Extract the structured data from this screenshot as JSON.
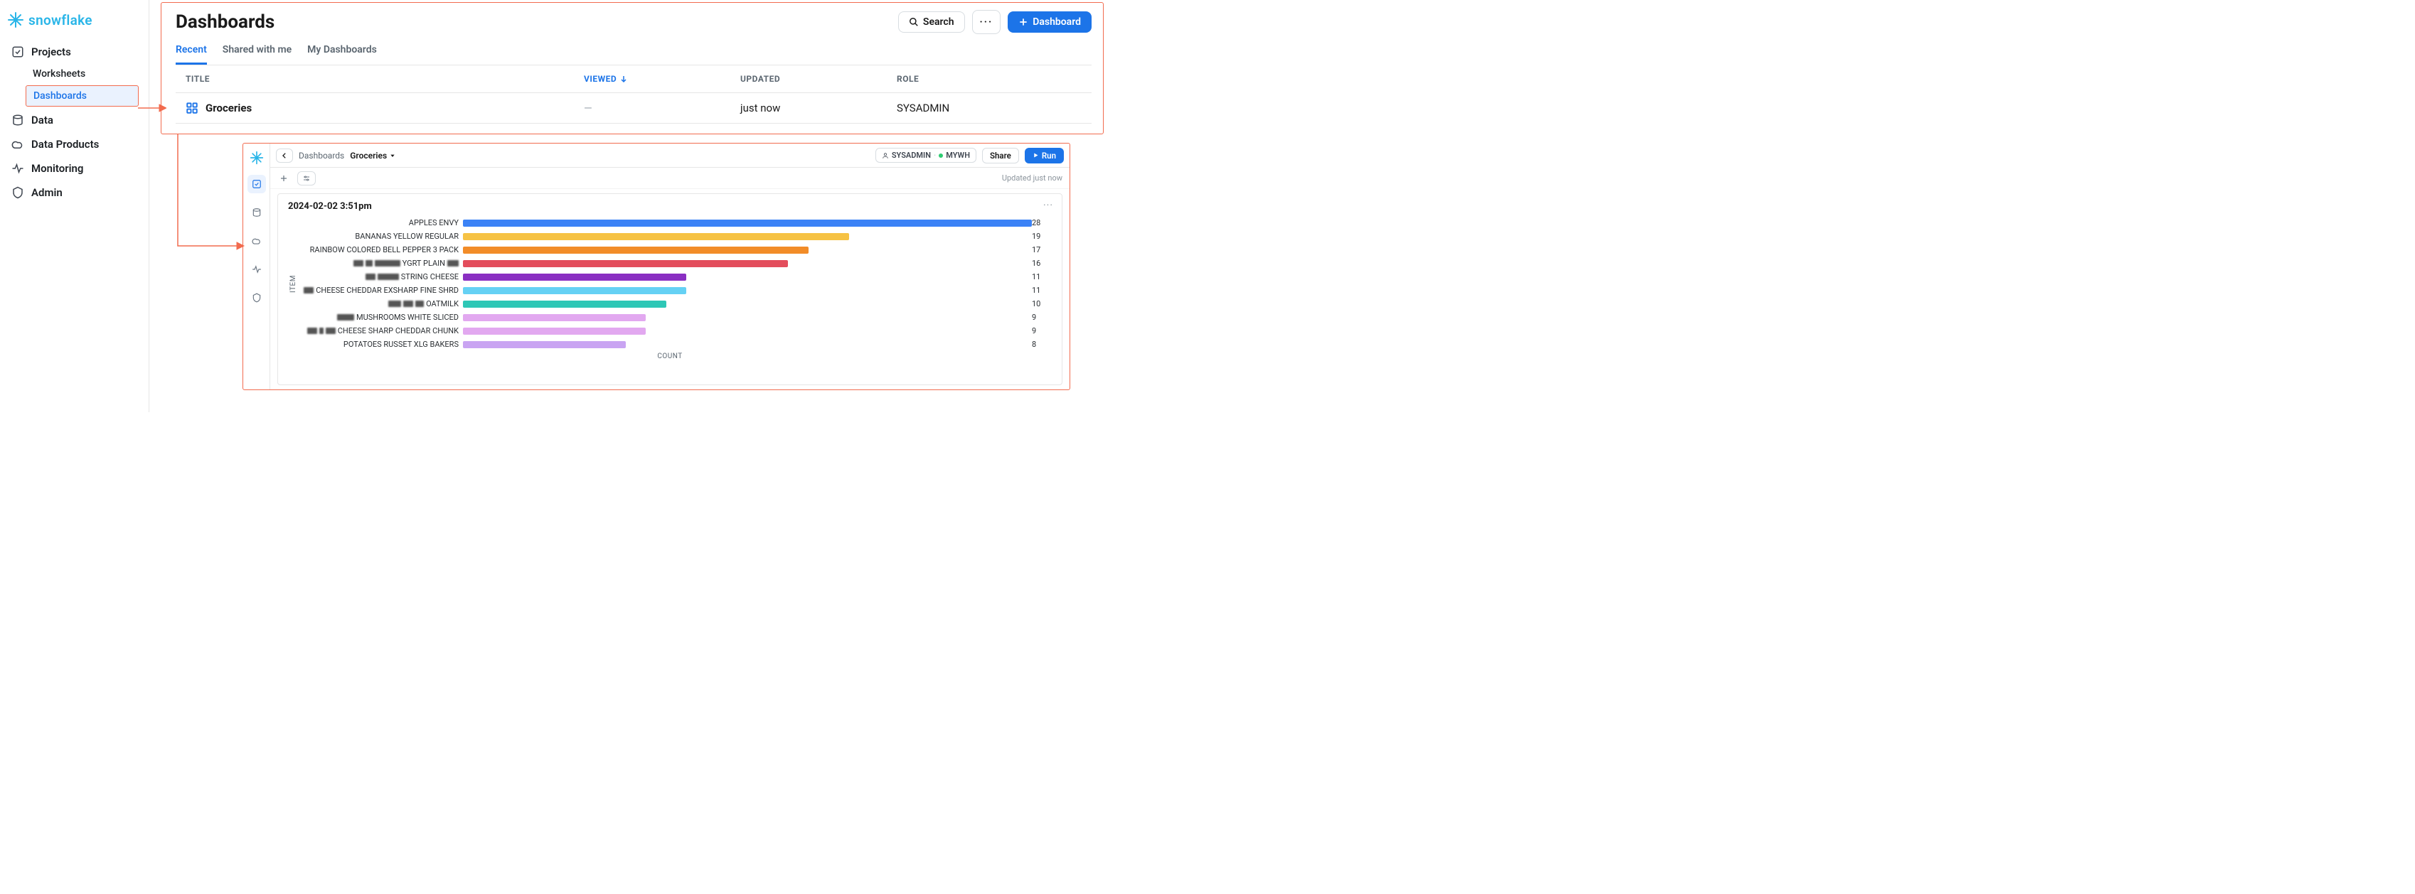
{
  "brand": "snowflake",
  "sidebar": {
    "items": [
      {
        "label": "Projects",
        "icon": "projects-icon"
      },
      {
        "label": "Data",
        "icon": "data-icon"
      },
      {
        "label": "Data Products",
        "icon": "data-products-icon"
      },
      {
        "label": "Monitoring",
        "icon": "monitoring-icon"
      },
      {
        "label": "Admin",
        "icon": "admin-icon"
      }
    ],
    "projects_sub": [
      {
        "label": "Worksheets",
        "active": false
      },
      {
        "label": "Dashboards",
        "active": true
      }
    ]
  },
  "main": {
    "title": "Dashboards",
    "search_label": "Search",
    "new_label": "Dashboard",
    "tabs": [
      {
        "label": "Recent",
        "active": true
      },
      {
        "label": "Shared with me",
        "active": false
      },
      {
        "label": "My Dashboards",
        "active": false
      }
    ],
    "cols": {
      "title": "TITLE",
      "viewed": "VIEWED",
      "updated": "UPDATED",
      "role": "ROLE"
    },
    "rows": [
      {
        "title": "Groceries",
        "viewed": "—",
        "updated": "just now",
        "role": "SYSADMIN"
      }
    ]
  },
  "dash": {
    "breadcrumb_parent": "Dashboards",
    "breadcrumb_current": "Groceries",
    "role_label": "SYSADMIN",
    "warehouse_label": "MYWH",
    "share_label": "Share",
    "run_label": "Run",
    "updated_label": "Updated just now",
    "tile_title": "2024-02-02 3:51pm",
    "xlabel": "COUNT",
    "ylabel": "ITEM"
  },
  "chart_data": {
    "type": "bar",
    "orientation": "horizontal",
    "xlabel": "COUNT",
    "ylabel": "ITEM",
    "xlim": [
      0,
      28
    ],
    "series": [
      {
        "label": "APPLES ENVY",
        "value": 28,
        "color": "#3b82f6",
        "redacted": []
      },
      {
        "label": "BANANAS YELLOW REGULAR",
        "value": 19,
        "color": "#f6c244",
        "redacted": []
      },
      {
        "label": "RAINBOW COLORED BELL PEPPER 3 PACK",
        "value": 17,
        "color": "#f28c28",
        "redacted": []
      },
      {
        "label": "YGRT PLAIN",
        "value": 16,
        "color": "#e34d5c",
        "redacted": [
          14,
          10,
          36
        ]
      },
      {
        "label": "STRING CHEESE",
        "value": 11,
        "color": "#8a2fc2",
        "redacted": [
          14,
          30
        ]
      },
      {
        "label": "CHEESE CHEDDAR EXSHARP FINE SHRD",
        "value": 11,
        "color": "#65d1f4",
        "redacted": [
          14
        ]
      },
      {
        "label": "OATMILK",
        "value": 10,
        "color": "#2ec7b6",
        "redacted": [
          18,
          14,
          12
        ]
      },
      {
        "label": "MUSHROOMS WHITE SLICED",
        "value": 9,
        "color": "#e2a8f0",
        "redacted": [
          24
        ]
      },
      {
        "label": "CHEESE SHARP CHEDDAR CHUNK",
        "value": 9,
        "color": "#e2a8f0",
        "redacted": [
          14,
          6,
          14
        ]
      },
      {
        "label": "POTATOES RUSSET XLG BAKERS",
        "value": 8,
        "color": "#c9a4f2",
        "redacted": []
      }
    ]
  }
}
